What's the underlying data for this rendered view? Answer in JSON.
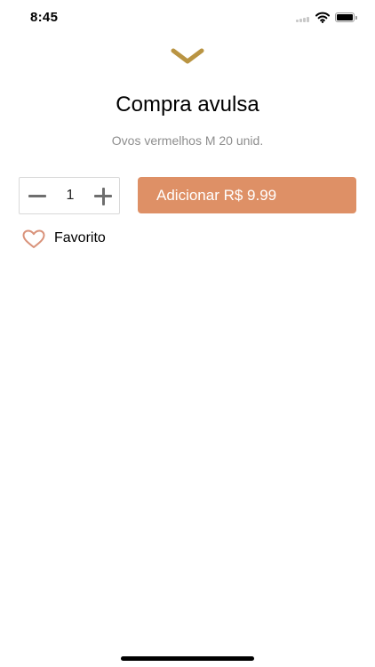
{
  "status_bar": {
    "time": "8:45",
    "icons": [
      "signal-icon",
      "wifi-icon",
      "battery-icon"
    ]
  },
  "header": {
    "collapse_icon": "chevron-down-icon",
    "title": "Compra avulsa",
    "subtitle": "Ovos vermelhos M 20 unid."
  },
  "purchase": {
    "quantity": "1",
    "add_button_label": "Adicionar R$ 9.99",
    "stepper_icons": [
      "minus-icon",
      "plus-icon"
    ]
  },
  "favorite": {
    "label": "Favorito",
    "icon": "heart-outline-icon"
  },
  "colors": {
    "accent_gold": "#b99442",
    "button_orange": "#de9066",
    "heart_outline": "#d9927a",
    "subtitle_gray": "#8e8e8e"
  }
}
